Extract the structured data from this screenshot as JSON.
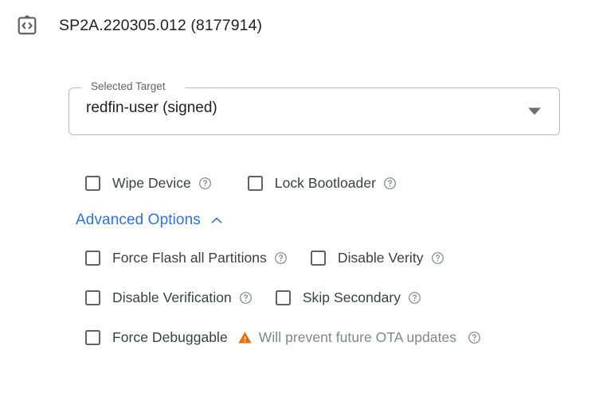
{
  "header": {
    "icon": "build-code-clipboard-icon",
    "title": "SP2A.220305.012 (8177914)"
  },
  "select": {
    "label": "Selected Target",
    "value": "redfin-user (signed)",
    "arrow_icon": "chevron-down-icon"
  },
  "basic_options": [
    {
      "label": "Wipe Device",
      "checked": false,
      "help_icon": "help-circle-icon"
    },
    {
      "label": "Lock Bootloader",
      "checked": false,
      "help_icon": "help-circle-icon"
    }
  ],
  "advanced": {
    "toggle_label": "Advanced Options",
    "toggle_icon": "chevron-up-icon",
    "expanded": true,
    "rows": [
      [
        {
          "label": "Force Flash all Partitions",
          "checked": false,
          "help_icon": "help-circle-icon"
        },
        {
          "label": "Disable Verity",
          "checked": false,
          "help_icon": "help-circle-icon"
        }
      ],
      [
        {
          "label": "Disable Verification",
          "checked": false,
          "help_icon": "help-circle-icon"
        },
        {
          "label": "Skip Secondary",
          "checked": false,
          "help_icon": "help-circle-icon"
        }
      ]
    ],
    "debuggable": {
      "label": "Force Debuggable",
      "checked": false,
      "warning_icon": "warning-triangle-icon",
      "warning_text": "Will prevent future OTA updates",
      "help_icon": "help-circle-icon"
    }
  },
  "colors": {
    "link_blue": "#2b72e8",
    "warning_orange": "#e8710a",
    "text_primary": "#202124",
    "text_secondary": "#5f6368",
    "border_grey": "#b9bdc2"
  }
}
